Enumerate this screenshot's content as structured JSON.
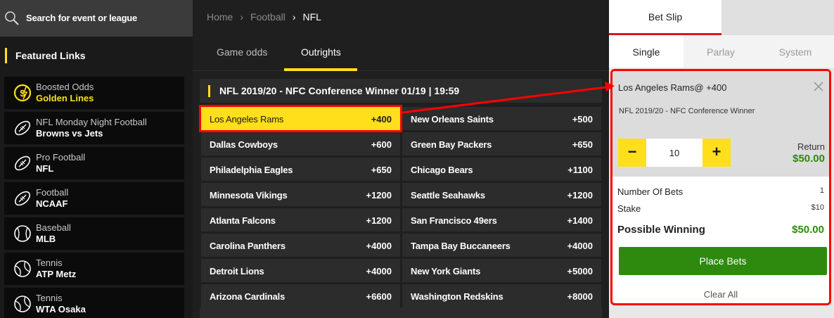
{
  "search": {
    "placeholder": "Search for event or league"
  },
  "featured": {
    "title": "Featured Links",
    "items": [
      {
        "line1": "Boosted Odds",
        "line2": "Golden Lines",
        "icon": "boosted-odds-icon",
        "highlight": true
      },
      {
        "line1": "NFL Monday Night Football",
        "line2": "Browns vs Jets",
        "icon": "football-icon"
      },
      {
        "line1": "Pro Football",
        "line2": "NFL",
        "icon": "football-icon"
      },
      {
        "line1": "Football",
        "line2": "NCAAF",
        "icon": "football-icon"
      },
      {
        "line1": "Baseball",
        "line2": "MLB",
        "icon": "baseball-icon"
      },
      {
        "line1": "Tennis",
        "line2": "ATP Metz",
        "icon": "tennis-ball-icon"
      },
      {
        "line1": "Tennis",
        "line2": "WTA Osaka",
        "icon": "tennis-ball-icon"
      }
    ]
  },
  "breadcrumb": {
    "home": "Home",
    "sport": "Football",
    "league": "NFL"
  },
  "tabs": {
    "game_odds": "Game odds",
    "outrights": "Outrights",
    "active": "Outrights"
  },
  "market": {
    "title": "NFL 2019/20 - NFC Conference Winner 01/19 | 19:59",
    "selections": [
      {
        "name": "Los Angeles Rams",
        "odds": "+400",
        "selected": true
      },
      {
        "name": "New Orleans Saints",
        "odds": "+500"
      },
      {
        "name": "Dallas Cowboys",
        "odds": "+600"
      },
      {
        "name": "Green Bay Packers",
        "odds": "+650"
      },
      {
        "name": "Philadelphia Eagles",
        "odds": "+650"
      },
      {
        "name": "Chicago Bears",
        "odds": "+1100"
      },
      {
        "name": "Minnesota Vikings",
        "odds": "+1200"
      },
      {
        "name": "Seattle Seahawks",
        "odds": "+1200"
      },
      {
        "name": "Atlanta Falcons",
        "odds": "+1200"
      },
      {
        "name": "San Francisco 49ers",
        "odds": "+1400"
      },
      {
        "name": "Carolina Panthers",
        "odds": "+4000"
      },
      {
        "name": "Tampa Bay Buccaneers",
        "odds": "+4000"
      },
      {
        "name": "Detroit Lions",
        "odds": "+4000"
      },
      {
        "name": "New York Giants",
        "odds": "+5000"
      },
      {
        "name": "Arizona Cardinals",
        "odds": "+6600"
      },
      {
        "name": "Washington Redskins",
        "odds": "+8000"
      }
    ]
  },
  "betslip": {
    "title": "Bet Slip",
    "modes": [
      "Single",
      "Parlay",
      "System"
    ],
    "active_mode": "Single",
    "bet": {
      "selection": "Los Angeles Rams@ +400",
      "market": "NFL 2019/20 - NFC Conference Winner",
      "stake_value": "10",
      "minus": "−",
      "plus": "+",
      "return_label": "Return",
      "return_value": "$50.00"
    },
    "summary": {
      "num_bets_label": "Number Of Bets",
      "num_bets_value": "1",
      "stake_label": "Stake",
      "stake_value": "$10",
      "possible_label": "Possible Winning",
      "possible_value": "$50.00"
    },
    "place_bets": "Place Bets",
    "clear_all": "Clear All"
  },
  "colors": {
    "accent": "#ffdf1b",
    "win_green": "#2d8a0e",
    "annotation_red": "#ff0000",
    "slip_tab_red": "#d61a1a"
  }
}
